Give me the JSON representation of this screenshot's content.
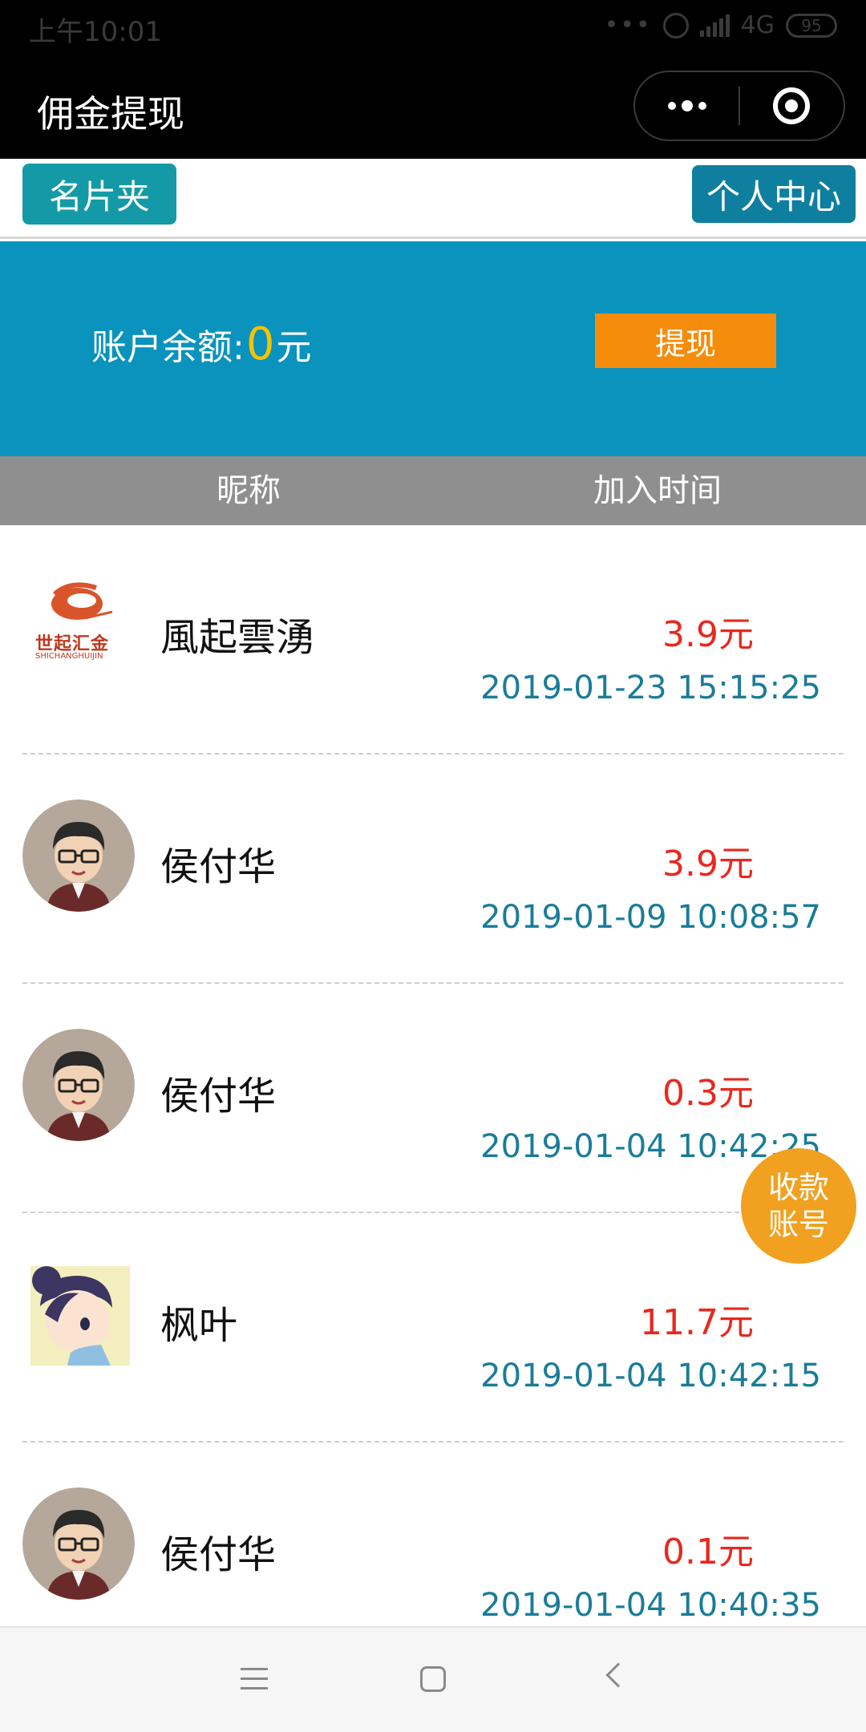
{
  "status_bar": {
    "time": "上午10:01",
    "signal_dots": "•••",
    "network": "4G",
    "battery": "95"
  },
  "title_bar": {
    "title": "佣金提现"
  },
  "nav": {
    "cards_label": "名片夹",
    "center_label": "个人中心"
  },
  "balance": {
    "label": "账户余额:",
    "amount": "0",
    "unit": "元",
    "withdraw_label": "提现"
  },
  "columns": {
    "nickname": "昵称",
    "join_time": "加入时间"
  },
  "records": [
    {
      "name": "風起雲湧",
      "amount": "3.9元",
      "time": "2019-01-23 15:15:25",
      "avatar": "company-logo"
    },
    {
      "name": "侯付华",
      "amount": "3.9元",
      "time": "2019-01-09 10:08:57",
      "avatar": "man-glasses"
    },
    {
      "name": "侯付华",
      "amount": "0.3元",
      "time": "2019-01-04 10:42:25",
      "avatar": "man-glasses"
    },
    {
      "name": "枫叶",
      "amount": "11.7元",
      "time": "2019-01-04 10:42:15",
      "avatar": "cartoon-girl"
    },
    {
      "name": "侯付华",
      "amount": "0.1元",
      "time": "2019-01-04 10:40:35",
      "avatar": "man-glasses"
    }
  ],
  "float_button": {
    "line1": "收款",
    "line2": "账号"
  },
  "logo": {
    "text_cn": "世起汇金",
    "text_en": "SHICHANGHUIJIN"
  },
  "colors": {
    "accent_blue": "#0993bd",
    "withdraw_orange": "#f68c0b",
    "amount_red": "#e8281e",
    "time_teal": "#1a7c99",
    "float_orange": "#f1a01f"
  }
}
